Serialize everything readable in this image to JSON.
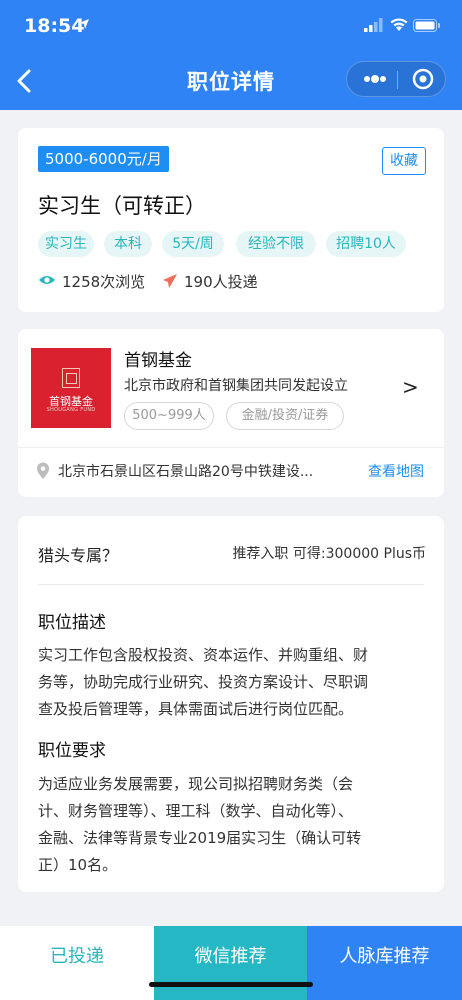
{
  "status_bar": {
    "time": "18:54"
  },
  "nav": {
    "title": "职位详情"
  },
  "job": {
    "salary": "5000-6000元/月",
    "favorite_label": "收藏",
    "title": "实习生（可转正）",
    "tags": [
      "实习生",
      "本科",
      "5天/周",
      "经验不限",
      "招聘10人"
    ],
    "views": "1258次浏览",
    "applications": "190人投递"
  },
  "company": {
    "logo_text": "首钢基金",
    "logo_subtext": "SHOUGANG FUND",
    "name": "首钢基金",
    "description": "北京市政府和首钢集团共同发起设立",
    "tags": [
      "500~999人",
      "金融/投资/证券"
    ],
    "chevron": ">",
    "address": "北京市石景山区石景山路20号中铁建设...",
    "map_link": "查看地图"
  },
  "details": {
    "hunter_label": "猎头专属？",
    "reward": "推荐入职 可得:300000 Plus币",
    "description_title": "职位描述",
    "description_lines": [
      "实习工作包含股权投资、资本运作、并购重组、财",
      "务等，协助完成行业研究、投资方案设计、尽职调",
      "查及投后管理等，具体需面试后进行岗位匹配。"
    ],
    "requirements_title": "职位要求",
    "requirements_lines": [
      "为适应业务发展需要，现公司拟招聘财务类（会",
      "计、财务管理等）、理工科（数学、自动化等）、",
      "金融、法律等背景专业2019届实习生（确认可转",
      "正）10名。"
    ]
  },
  "bottom_bar": {
    "applied_label": "已投递",
    "wechat_label": "微信推荐",
    "network_label": "人脉库推荐"
  },
  "colors": {
    "header_blue": "#2f83f4",
    "accent_blue": "#1e8ef5",
    "teal": "#2bb5bf",
    "logo_red": "#d9212f"
  }
}
